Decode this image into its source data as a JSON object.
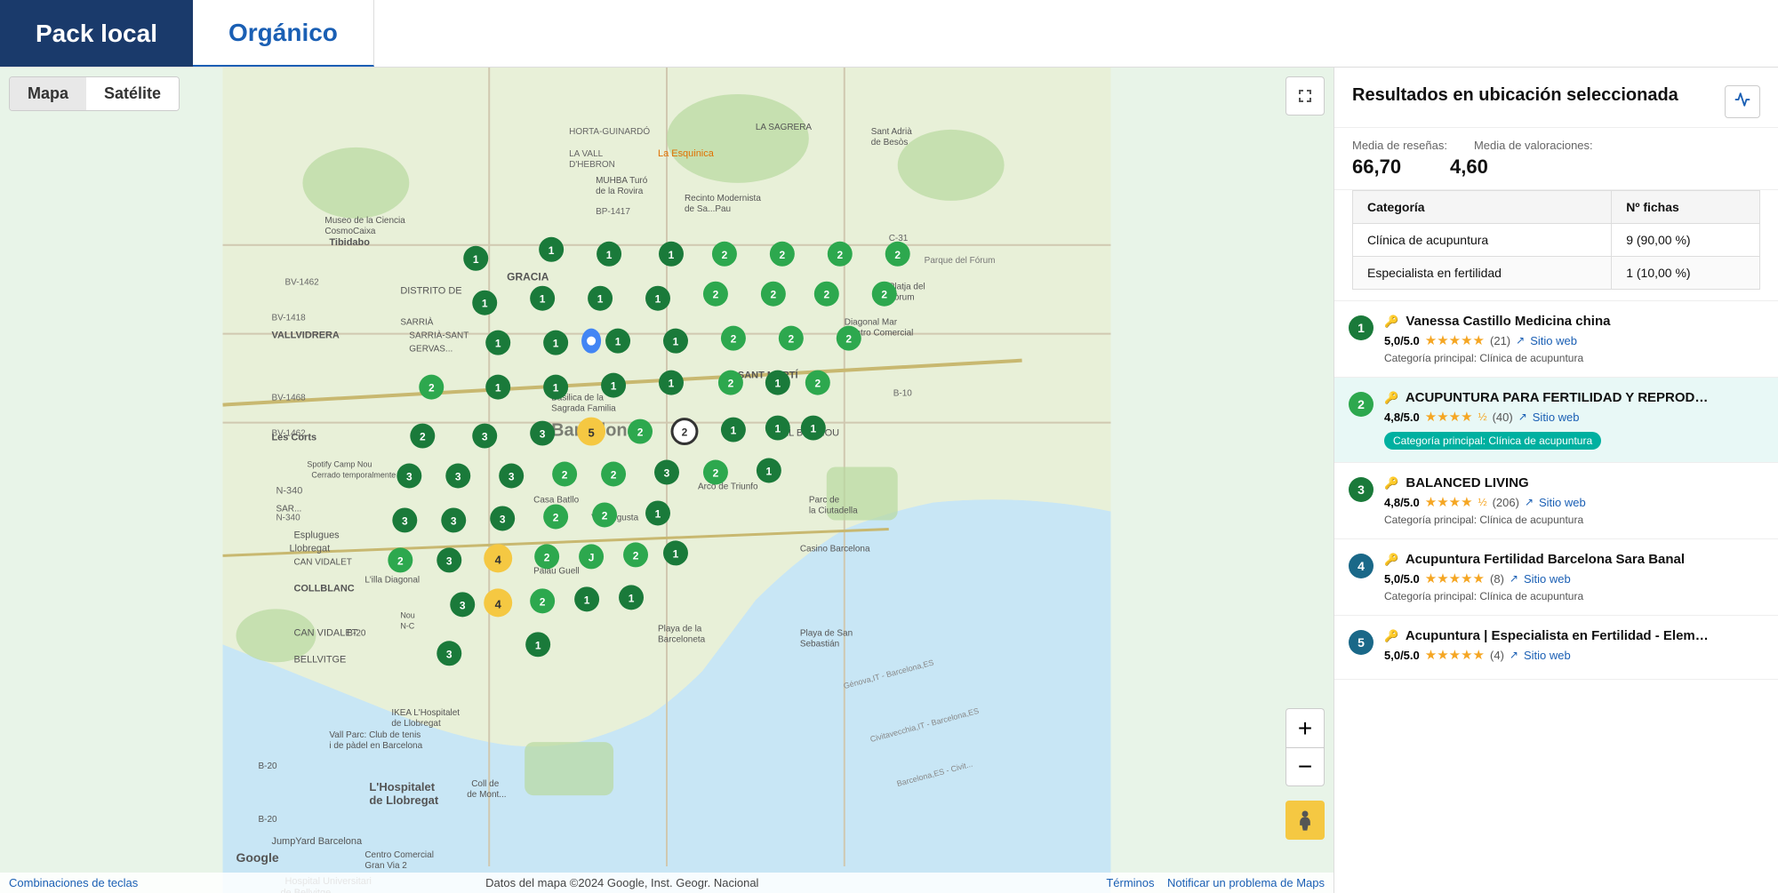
{
  "tabs": [
    {
      "id": "pack-local",
      "label": "Pack local",
      "active": true
    },
    {
      "id": "organico",
      "label": "Orgánico",
      "active": false
    }
  ],
  "map": {
    "type_buttons": [
      "Mapa",
      "Satélite"
    ],
    "active_type": "Mapa",
    "footer_left": "Combinaciones de teclas",
    "footer_center": "Datos del mapa ©2024 Google, Inst. Geogr. Nacional",
    "footer_right_terms": "Términos",
    "footer_right_report": "Notificar un problema de Maps",
    "city_label": "Barcelona"
  },
  "results_panel": {
    "title": "Resultados en ubicación seleccionada",
    "stats": {
      "reviews_label": "Media de reseñas:",
      "ratings_label": "Media de valoraciones:",
      "reviews_value": "66,70",
      "ratings_value": "4,60"
    },
    "table_headers": [
      "Categoría",
      "Nº fichas"
    ],
    "categories": [
      {
        "name": "Clínica de acupuntura",
        "count": "9 (90,00 %)"
      },
      {
        "name": "Especialista en fertilidad",
        "count": "1 (10,00 %)"
      }
    ],
    "results": [
      {
        "number": 1,
        "name": "Vanessa Castillo Medicina china",
        "rating": "5,0/5.0",
        "stars": "★★★★★",
        "review_count": "(21)",
        "site_label": "Sitio web",
        "category": "Clínica de acupuntura",
        "highlighted": false
      },
      {
        "number": 2,
        "name": "ACUPUNTURA PARA FERTILIDAD Y REPRODUCCION ASISTIDA DUR...",
        "rating": "4,8/5.0",
        "stars": "★★★★½",
        "review_count": "(40)",
        "site_label": "Sitio web",
        "category": "Clínica de acupuntura",
        "highlighted": true
      },
      {
        "number": 3,
        "name": "BALANCED LIVING",
        "rating": "4,8/5.0",
        "stars": "★★★★½",
        "review_count": "(206)",
        "site_label": "Sitio web",
        "category": "Clínica de acupuntura",
        "highlighted": false
      },
      {
        "number": 4,
        "name": "Acupuntura Fertilidad Barcelona Sara Banal",
        "rating": "5,0/5.0",
        "stars": "★★★★★",
        "review_count": "(8)",
        "site_label": "Sitio web",
        "category": "Clínica de acupuntura",
        "highlighted": false
      },
      {
        "number": 5,
        "name": "Acupuntura | Especialista en Fertilidad - Elemento Tierra",
        "rating": "5,0/5.0",
        "stars": "★★★★★",
        "review_count": "(4)",
        "site_label": "Sitio web",
        "category": "",
        "highlighted": false,
        "partial": true
      }
    ]
  },
  "colors": {
    "active_tab_bg": "#1a3a6b",
    "active_tab_text": "#ffffff",
    "inactive_tab_text": "#1a5fb4",
    "pin_green_dark": "#1a7a3a",
    "pin_green_light": "#2da84e",
    "pin_yellow": "#f5c842",
    "pin_teal": "#1a8a8a",
    "accent": "#1a5fb4",
    "highlight_badge": "#00b0a0"
  }
}
